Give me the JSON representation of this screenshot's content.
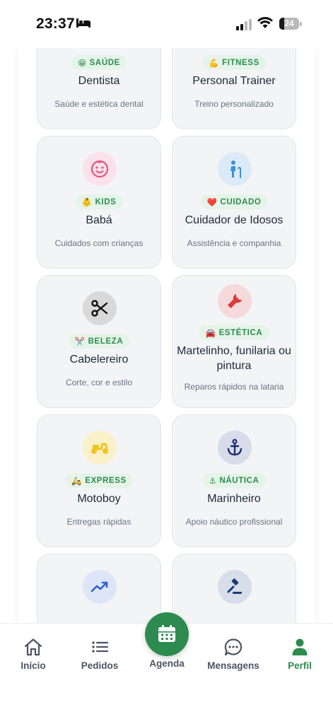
{
  "status_bar": {
    "time": "23:37",
    "battery": "24"
  },
  "cards": [
    {
      "badge_emoji": "😁",
      "badge": "SAÚDE",
      "title": "Dentista",
      "subtitle": "Saúde e estética dental",
      "icon": "tooth-icon",
      "icon_bg": "#d8f1f3"
    },
    {
      "badge_emoji": "💪",
      "badge": "FITNESS",
      "title": "Personal Trainer",
      "subtitle": "Treino personalizado",
      "icon": "dumbbell-icon",
      "icon_bg": "#fde9cf"
    },
    {
      "badge_emoji": "👶",
      "badge": "KIDS",
      "title": "Babá",
      "subtitle": "Cuidados com crianças",
      "icon": "baby-face-icon",
      "icon_bg": "#fbe1ea"
    },
    {
      "badge_emoji": "❤️",
      "badge": "CUIDADO",
      "title": "Cuidador de Idosos",
      "subtitle": "Assistência e companhia",
      "icon": "elderly-person-icon",
      "icon_bg": "#dbeaf8"
    },
    {
      "badge_emoji": "✂️",
      "badge": "BELEZA",
      "title": "Cabelereiro",
      "subtitle": "Corte, cor e estilo",
      "icon": "scissors-icon",
      "icon_bg": "#d9d9d9"
    },
    {
      "badge_emoji": "🚘",
      "badge": "ESTÉTICA",
      "title": "Martelinho, funilaria ou pintura",
      "subtitle": "Reparos rápidos na lataria",
      "icon": "wrench-icon",
      "icon_bg": "#f6d9db"
    },
    {
      "badge_emoji": "🛵",
      "badge": "EXPRESS",
      "title": "Motoboy",
      "subtitle": "Entregas rápidas",
      "icon": "scooter-icon",
      "icon_bg": "#faf1c9"
    },
    {
      "badge_emoji": "⚓",
      "badge": "NÁUTICA",
      "title": "Marinheiro",
      "subtitle": "Apoio náutico profissional",
      "icon": "anchor-icon",
      "icon_bg": "#d7dbea"
    },
    {
      "icon": "trending-up-icon",
      "icon_bg": "#dde6f8"
    },
    {
      "icon": "gavel-icon",
      "icon_bg": "#d7dde9"
    }
  ],
  "tabs": [
    {
      "label": "Início",
      "icon": "home-icon"
    },
    {
      "label": "Pedidos",
      "icon": "list-icon"
    },
    {
      "label": "Agenda",
      "icon": "calendar-icon"
    },
    {
      "label": "Mensagens",
      "icon": "chat-bubble-icon"
    },
    {
      "label": "Perfil",
      "icon": "person-icon"
    }
  ],
  "colors": {
    "accent": "#2e8b4f",
    "badge_bg": "#e5f4e9",
    "card_bg": "#f3f4f6"
  }
}
